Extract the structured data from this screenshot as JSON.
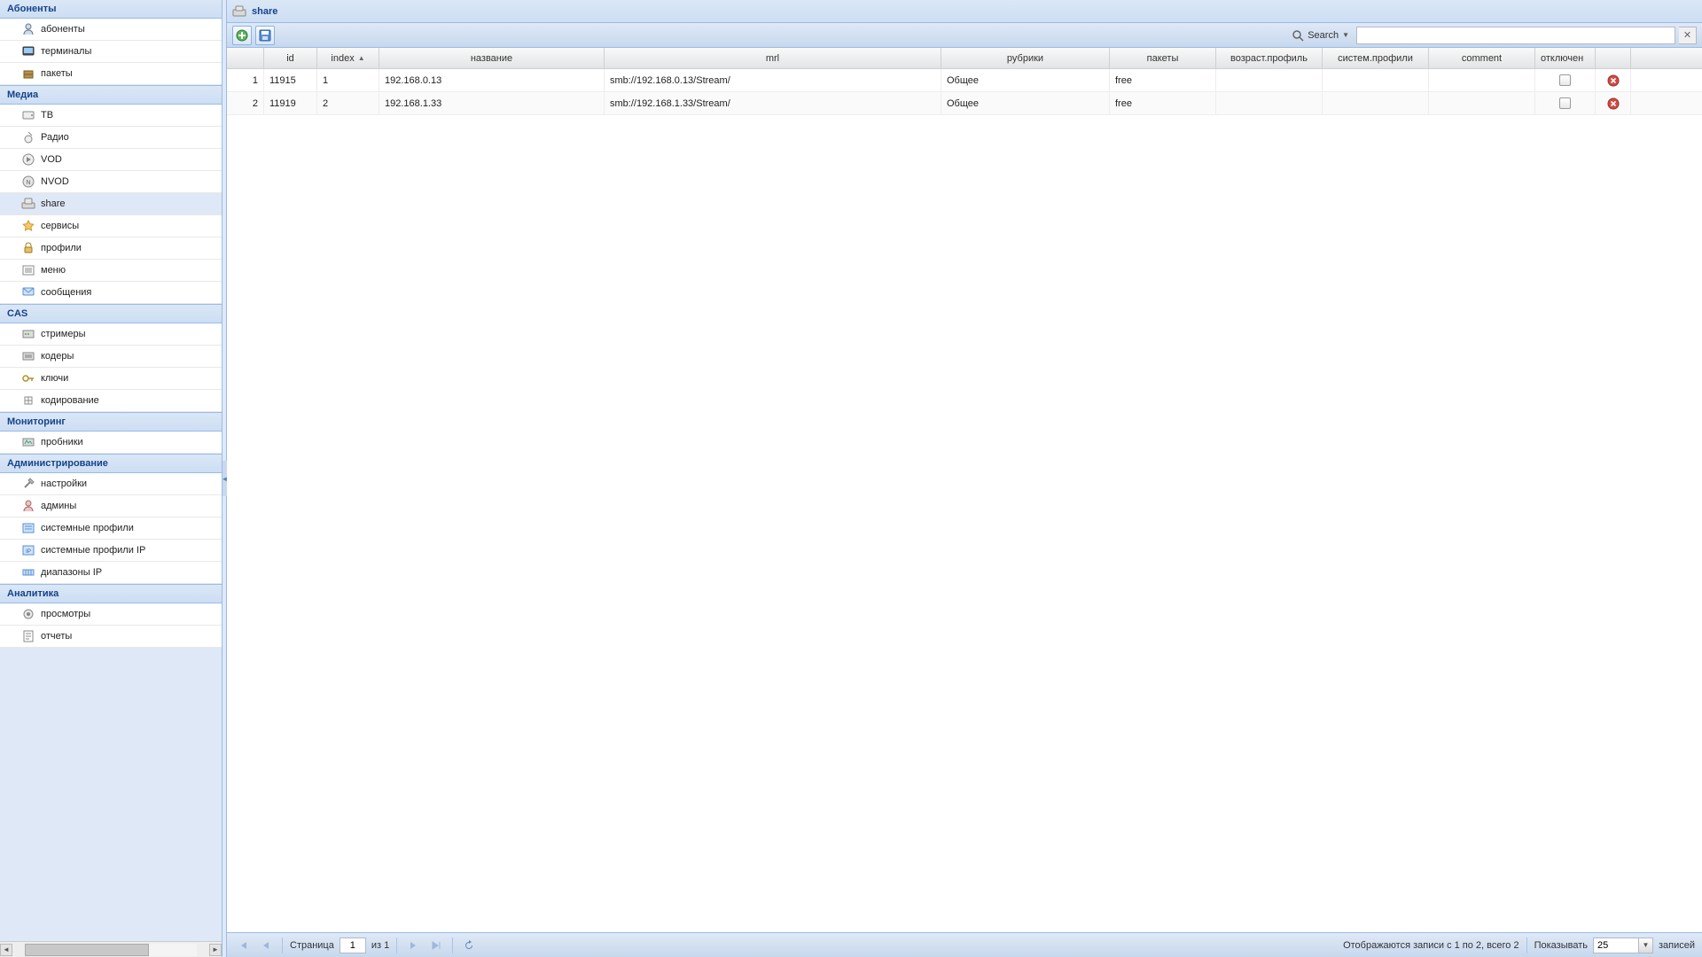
{
  "sidebar": {
    "groups": [
      {
        "title": "Абоненты",
        "items": [
          {
            "label": "абоненты",
            "icon": "user-icon"
          },
          {
            "label": "терминалы",
            "icon": "terminal-icon"
          },
          {
            "label": "пакеты",
            "icon": "package-icon"
          }
        ]
      },
      {
        "title": "Медиа",
        "items": [
          {
            "label": "ТВ",
            "icon": "tv-icon"
          },
          {
            "label": "Радио",
            "icon": "radio-icon"
          },
          {
            "label": "VOD",
            "icon": "vod-icon"
          },
          {
            "label": "NVOD",
            "icon": "nvod-icon"
          },
          {
            "label": "share",
            "icon": "share-icon",
            "selected": true
          },
          {
            "label": "сервисы",
            "icon": "star-icon"
          },
          {
            "label": "профили",
            "icon": "lock-icon"
          },
          {
            "label": "меню",
            "icon": "menu-icon"
          },
          {
            "label": "сообщения",
            "icon": "message-icon"
          }
        ]
      },
      {
        "title": "CAS",
        "items": [
          {
            "label": "стримеры",
            "icon": "streamer-icon"
          },
          {
            "label": "кодеры",
            "icon": "coder-icon"
          },
          {
            "label": "ключи",
            "icon": "key-icon"
          },
          {
            "label": "кодирование",
            "icon": "encoding-icon"
          }
        ]
      },
      {
        "title": "Мониторинг",
        "items": [
          {
            "label": "пробники",
            "icon": "probe-icon"
          }
        ]
      },
      {
        "title": "Администрирование",
        "items": [
          {
            "label": "настройки",
            "icon": "settings-icon"
          },
          {
            "label": "админы",
            "icon": "admin-icon"
          },
          {
            "label": "системные профили",
            "icon": "sysprofile-icon"
          },
          {
            "label": "системные профили IP",
            "icon": "sysprofile-ip-icon"
          },
          {
            "label": "диапазоны IP",
            "icon": "iprange-icon"
          }
        ]
      },
      {
        "title": "Аналитика",
        "items": [
          {
            "label": "просмотры",
            "icon": "views-icon"
          },
          {
            "label": "отчеты",
            "icon": "reports-icon"
          }
        ]
      }
    ]
  },
  "panel": {
    "title": "share"
  },
  "toolbar": {
    "add_tooltip": "Добавить",
    "save_tooltip": "Сохранить",
    "search_label": "Search",
    "search_value": "",
    "search_placeholder": ""
  },
  "grid": {
    "columns": {
      "rownum": "",
      "id": "id",
      "index": "index",
      "name": "название",
      "mrl": "mrl",
      "rubrics": "рубрики",
      "packets": "пакеты",
      "age_profile": "возраст.профиль",
      "sys_profiles": "систем.профили",
      "comment": "comment",
      "disabled": "отключен"
    },
    "sort": {
      "column": "index",
      "dir": "asc"
    },
    "rows": [
      {
        "rownum": "1",
        "id": "11915",
        "index": "1",
        "name": "192.168.0.13",
        "mrl": "smb://192.168.0.13/Stream/",
        "rubrics": "Общее",
        "packets": "free",
        "age_profile": "",
        "sys_profiles": "",
        "comment": "",
        "disabled": false
      },
      {
        "rownum": "2",
        "id": "11919",
        "index": "2",
        "name": "192.168.1.33",
        "mrl": "smb://192.168.1.33/Stream/",
        "rubrics": "Общее",
        "packets": "free",
        "age_profile": "",
        "sys_profiles": "",
        "comment": "",
        "disabled": false
      }
    ]
  },
  "paging": {
    "page_label": "Страница",
    "page_value": "1",
    "of_label": "из 1",
    "display_msg": "Отображаются записи с 1 по 2, всего 2",
    "show_label": "Показывать",
    "page_size": "25",
    "records_label": "записей"
  }
}
